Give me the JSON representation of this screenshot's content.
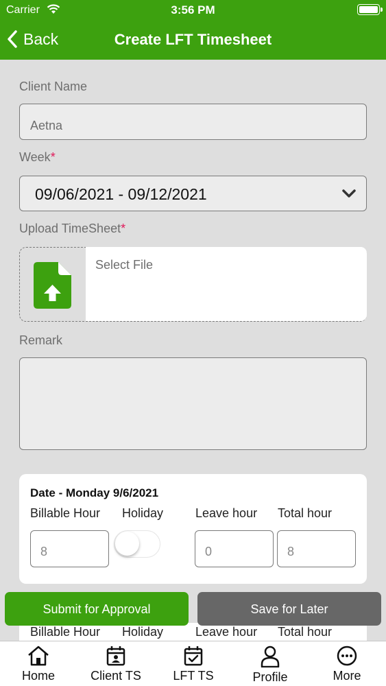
{
  "status_bar": {
    "carrier": "Carrier",
    "time": "3:56 PM"
  },
  "nav": {
    "back_label": "Back",
    "title": "Create LFT Timesheet"
  },
  "form": {
    "client_name": {
      "label": "Client Name",
      "value": "Aetna"
    },
    "week": {
      "label": "Week",
      "required_mark": "*",
      "value": "09/06/2021 - 09/12/2021"
    },
    "upload": {
      "label": "Upload TimeSheet",
      "required_mark": "*",
      "placeholder": "Select File"
    },
    "remark": {
      "label": "Remark",
      "value": ""
    }
  },
  "day_entry": {
    "date": "Date - Monday 9/6/2021",
    "columns": {
      "billable": "Billable Hour",
      "holiday": "Holiday",
      "leave": "Leave hour",
      "total": "Total hour"
    },
    "billable_value": "8",
    "holiday_on": false,
    "leave_value": "0",
    "total_value": "8"
  },
  "next_day_columns": {
    "billable": "Billable Hour",
    "holiday": "Holiday",
    "leave": "Leave hour",
    "total": "Total hour"
  },
  "actions": {
    "submit": "Submit for Approval",
    "save": "Save for Later"
  },
  "tabs": [
    {
      "label": "Home",
      "icon": "home-icon"
    },
    {
      "label": "Client TS",
      "icon": "client-calendar-icon"
    },
    {
      "label": "LFT TS",
      "icon": "calendar-check-icon"
    },
    {
      "label": "Profile",
      "icon": "person-icon"
    },
    {
      "label": "More",
      "icon": "more-icon"
    }
  ],
  "colors": {
    "brand_green": "#3da10f",
    "save_gray": "#676767",
    "required": "#e0195a",
    "background": "#dedede"
  }
}
